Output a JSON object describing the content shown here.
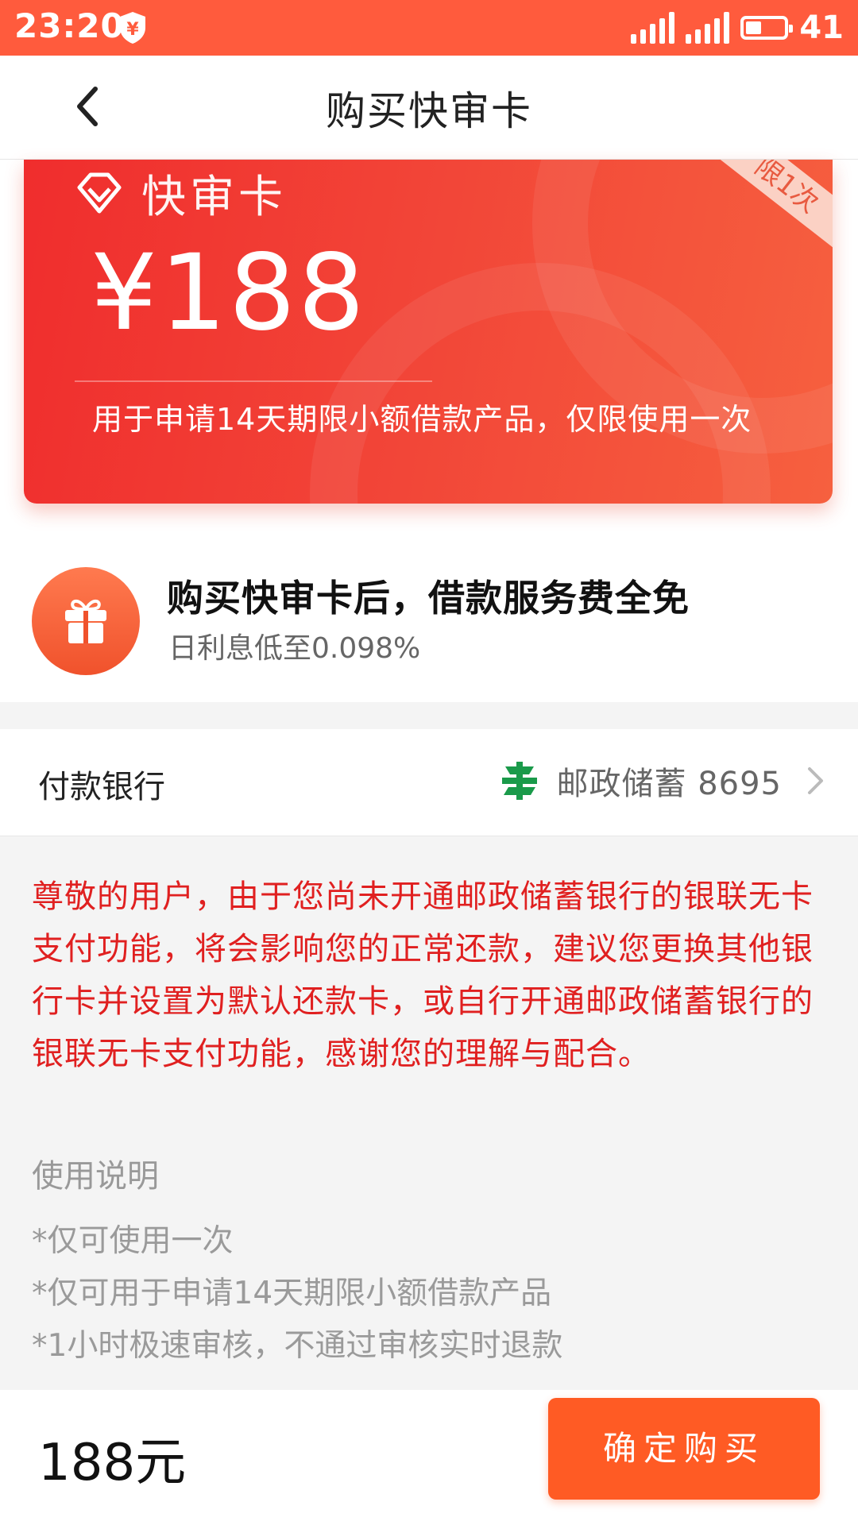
{
  "status_bar": {
    "time": "23:20",
    "battery": "41",
    "network": "4G",
    "battery_level_fraction": 0.41
  },
  "nav": {
    "title": "购买快审卡"
  },
  "card": {
    "title": "快审卡",
    "price": "¥188",
    "ribbon": "限1次",
    "description": "用于申请14天期限小额借款产品，仅限使用一次"
  },
  "benefit": {
    "title": "购买快审卡后，借款服务费全免",
    "subtitle": "日利息低至0.098%"
  },
  "payment": {
    "label": "付款银行",
    "bank": "邮政储蓄 8695"
  },
  "notice": "尊敬的用户，由于您尚未开通邮政储蓄银行的银联无卡支付功能，将会影响您的正常还款，建议您更换其他银行卡并设置为默认还款卡，或自行开通邮政储蓄银行的银联无卡支付功能，感谢您的理解与配合。",
  "usage": {
    "title": "使用说明",
    "items": [
      "*仅可使用一次",
      "*仅可用于申请14天期限小额借款产品",
      "*1小时极速审核，不通过审核实时退款"
    ]
  },
  "footer": {
    "total": "188元",
    "confirm": "确定购买"
  },
  "colors": {
    "status_bar": "#ff5b3d",
    "card_red": "#f24638",
    "accent_orange": "#ff5b24",
    "notice_red": "#e02020"
  }
}
